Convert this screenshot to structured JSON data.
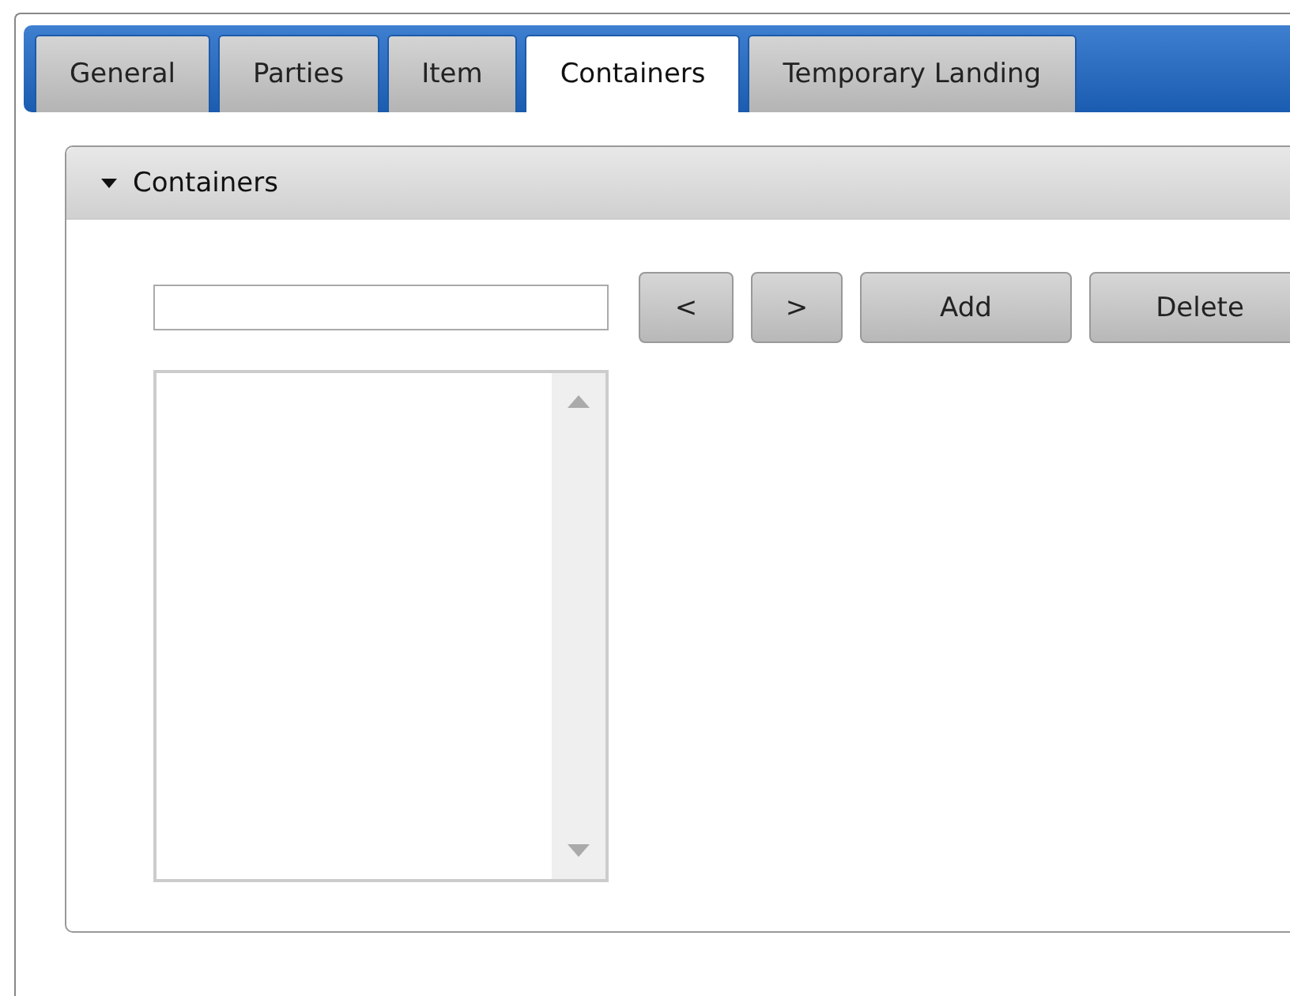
{
  "tabs": [
    {
      "label": "General",
      "selected": false
    },
    {
      "label": "Parties",
      "selected": false
    },
    {
      "label": "Item",
      "selected": false
    },
    {
      "label": "Containers",
      "selected": true
    },
    {
      "label": "Temporary Landing",
      "selected": false
    }
  ],
  "section": {
    "title": "Containers",
    "expanded": true,
    "buttons": [
      "<",
      ">",
      "Add",
      "Delete"
    ]
  }
}
